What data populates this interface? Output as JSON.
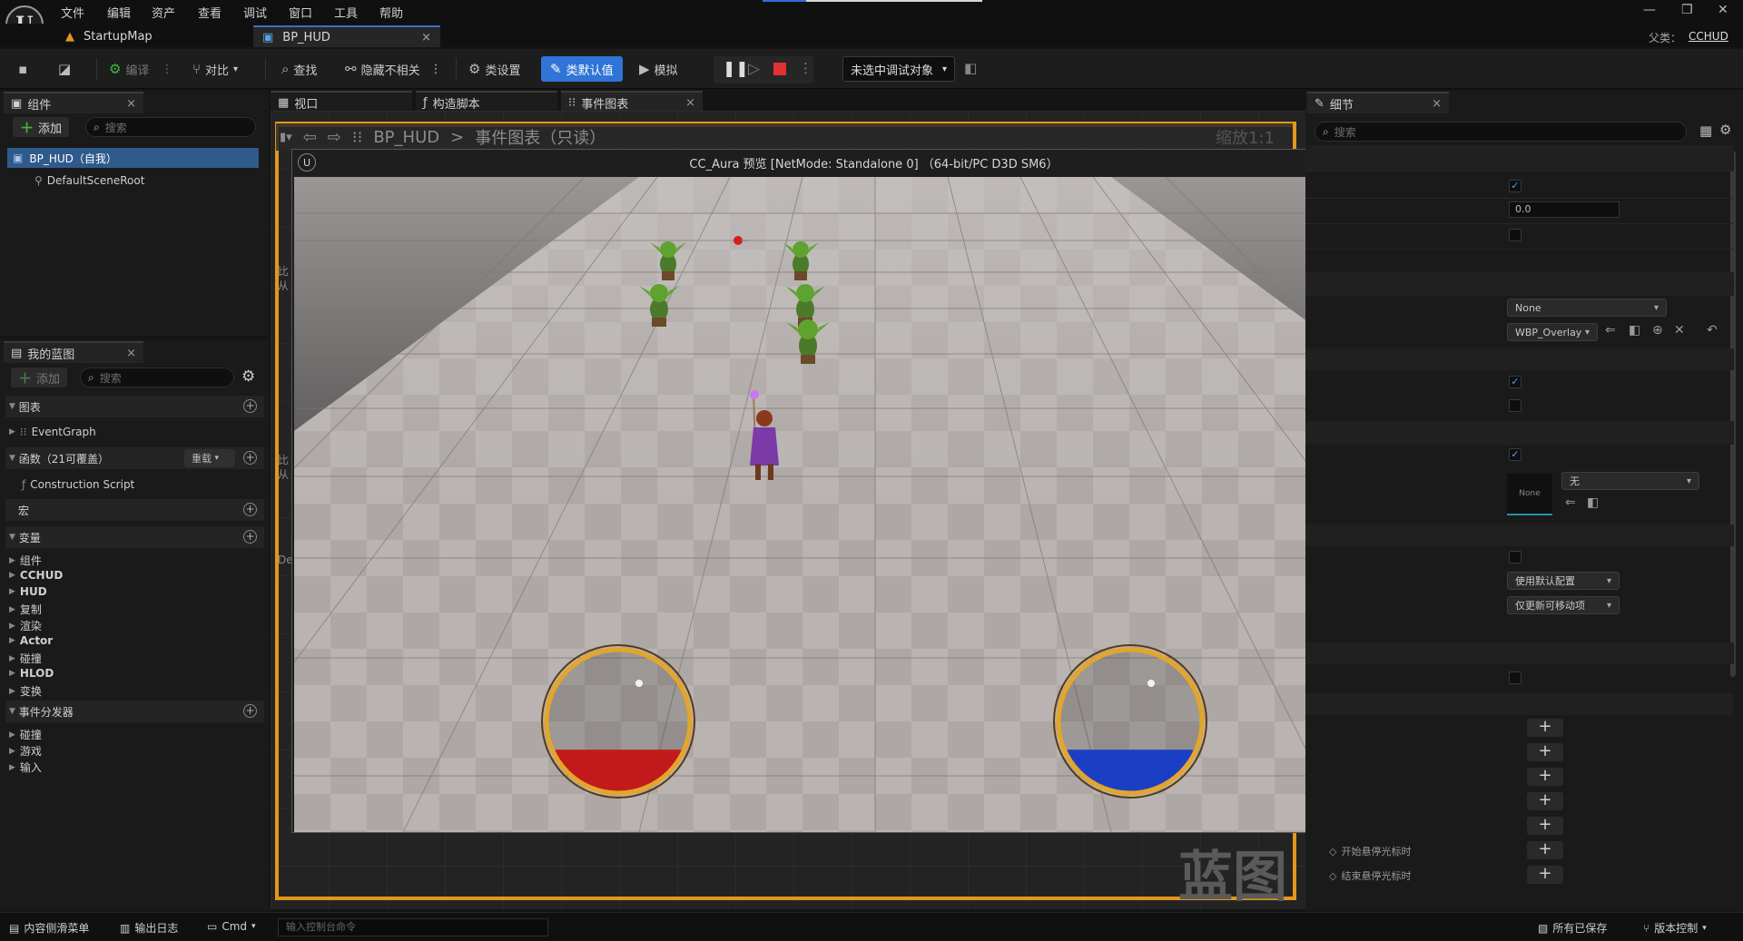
{
  "menubar": {
    "items": [
      "文件",
      "编辑",
      "资产",
      "查看",
      "调试",
      "窗口",
      "工具",
      "帮助"
    ],
    "parent_label": "父类：",
    "parent_value": "CCHUD"
  },
  "tabs": {
    "map": "StartupMap",
    "blueprint": "BP_HUD",
    "close": "×"
  },
  "toolbar": {
    "compile": "编译",
    "diff": "对比",
    "find": "查找",
    "hide_unrelated": "隐藏不相关",
    "class_settings": "类设置",
    "class_defaults": "类默认值",
    "simulate": "模拟",
    "debug_target": "未选中调试对象"
  },
  "components_panel": {
    "title": "组件",
    "add": "添加",
    "search_placeholder": "搜索",
    "items": [
      "BP_HUD（自我）",
      "DefaultSceneRoot"
    ]
  },
  "my_blueprint": {
    "title": "我的蓝图",
    "add": "添加",
    "search_placeholder": "搜索",
    "graphs": "图表",
    "event_graph": "EventGraph",
    "functions": "函数（21可覆盖）",
    "override": "重载",
    "construction_script": "Construction Script",
    "macros": "宏",
    "variables": "变量",
    "variable_categories": [
      "组件",
      "CCHUD",
      "HUD",
      "复制",
      "渲染",
      "Actor",
      "碰撞",
      "HLOD",
      "变换"
    ],
    "event_dispatchers": "事件分发器",
    "dispatcher_categories": [
      "碰撞",
      "游戏",
      "输入"
    ]
  },
  "editor_tabs": {
    "viewport": "视口",
    "construction": "构造脚本",
    "event_graph": "事件图表"
  },
  "breadcrumb": {
    "root": "BP_HUD",
    "sep": ">",
    "current": "事件图表（只读）",
    "zoom": "缩放1:1"
  },
  "graph": {
    "watermark": "蓝图",
    "side_labels": [
      "比",
      "从",
      "比",
      "从",
      "De"
    ]
  },
  "game_window": {
    "title": "CC_Aura 预览 [NetMode: Standalone 0] （64-bit/PC D3D SM6）",
    "health_fill": 0.3,
    "mana_fill": 0.3,
    "health_color": "#c21a1a",
    "mana_color": "#1a3fc4",
    "frame_color": "#e3a52a"
  },
  "details": {
    "title": "细节",
    "search_placeholder": "搜索",
    "float_value": "0.0",
    "dd_none": "None",
    "dd_overlay": "WBP_Overlay",
    "dd_wu": "无",
    "thumb_none": "None",
    "dd_default_config": "使用默认配置",
    "dd_movable": "仅更新可移动项",
    "begin_hover": "开始悬停光标时",
    "end_hover": "结束悬停光标时"
  },
  "statusbar": {
    "content_drawer": "内容侧滑菜单",
    "output_log": "输出日志",
    "cmd": "Cmd",
    "console_placeholder": "输入控制台命令",
    "all_saved": "所有已保存",
    "source_control": "版本控制"
  }
}
